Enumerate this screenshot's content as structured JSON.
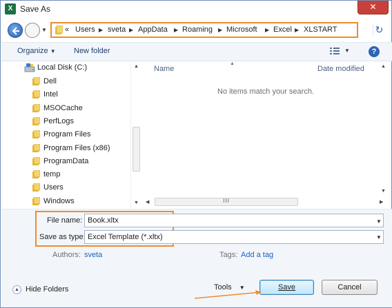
{
  "window": {
    "title": "Save As",
    "app_icon": "excel-icon",
    "app_icon_letter": "X",
    "close_glyph": "✕"
  },
  "address": {
    "overflow": "«",
    "crumbs": [
      "Users",
      "sveta",
      "AppData",
      "Roaming",
      "Microsoft",
      "Excel",
      "XLSTART"
    ],
    "highlight_color": "#f08a2b"
  },
  "toolbar": {
    "organize": "Organize",
    "new_folder": "New folder",
    "help": "?"
  },
  "nav_pane": {
    "drive": "Local Disk (C:)",
    "folders": [
      "Dell",
      "Intel",
      "MSOCache",
      "PerfLogs",
      "Program Files",
      "Program Files (x86)",
      "ProgramData",
      "temp",
      "Users",
      "Windows"
    ]
  },
  "list": {
    "columns": [
      "Name",
      "Date modified"
    ],
    "empty_message": "No items match your search.",
    "hscroll_grip": "III"
  },
  "details": {
    "file_name_label": "File name:",
    "file_name_value": "Book.xltx",
    "save_type_label": "Save as type:",
    "save_type_value": "Excel Template (*.xltx)",
    "authors_label": "Authors:",
    "authors_value": "sveta",
    "tags_label": "Tags:",
    "tags_value": "Add a tag"
  },
  "footer": {
    "hide_folders": "Hide Folders",
    "tools": "Tools",
    "save": "Save",
    "cancel": "Cancel"
  }
}
